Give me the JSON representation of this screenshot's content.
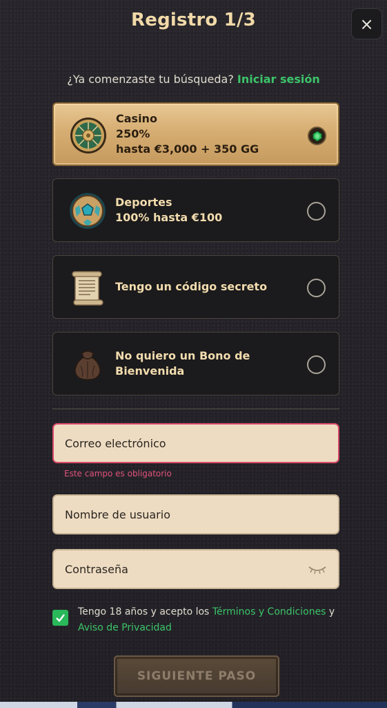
{
  "header": {
    "title": "Registro 1/3",
    "close_glyph": "×"
  },
  "login_prompt": {
    "question": "¿Ya comenzaste tu búsqueda?",
    "link": "Iniciar sesión"
  },
  "options": [
    {
      "icon": "roulette-icon",
      "lines": [
        "Casino",
        "250%",
        "hasta €3,000 + 350 GG"
      ],
      "selected": true
    },
    {
      "icon": "soccer-ball-icon",
      "lines": [
        "Deportes",
        "100% hasta €100"
      ],
      "selected": false
    },
    {
      "icon": "scroll-icon",
      "lines": [
        "Tengo un código secreto"
      ],
      "selected": false
    },
    {
      "icon": "pouch-icon",
      "lines": [
        "No quiero un Bono de",
        "Bienvenida"
      ],
      "selected": false
    }
  ],
  "form": {
    "email_placeholder": "Correo electrónico",
    "email_error": "Este campo es obligatorio",
    "username_placeholder": "Nombre de usuario",
    "password_placeholder": "Contraseña"
  },
  "terms": {
    "checked": true,
    "text_before": "Tengo 18 años y acepto los ",
    "terms_link": "Términos y Condiciones",
    "text_middle": " y ",
    "privacy_link": "Aviso de Privacidad"
  },
  "next_button": "SIGUIENTE PASO",
  "colors": {
    "accent_green": "#3cc46a",
    "gold": "#f1d9a8",
    "error": "#e0527a"
  }
}
